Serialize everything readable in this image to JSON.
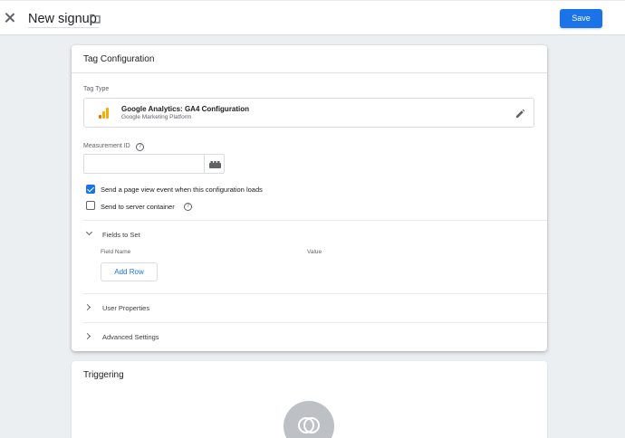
{
  "header": {
    "close_icon": "close-icon",
    "title": "New signup",
    "folder_icon": "folder-icon",
    "save_label": "Save"
  },
  "tag_config": {
    "title": "Tag Configuration",
    "tag_type_label": "Tag Type",
    "tag_type": {
      "name": "Google Analytics: GA4 Configuration",
      "provider": "Google Marketing Platform",
      "icon": "google-analytics-icon",
      "edit_icon": "pencil-icon"
    },
    "measurement_id": {
      "label": "Measurement ID",
      "value": "",
      "help_icon": "help-icon",
      "variable_icon": "variable-picker-icon"
    },
    "options": [
      {
        "label": "Send a page view event when this configuration loads",
        "checked": true
      },
      {
        "label": "Send to server container",
        "checked": false
      }
    ],
    "fields_to_set": {
      "title": "Fields to Set",
      "expanded": true,
      "columns": [
        "Field Name",
        "Value"
      ],
      "add_row_label": "Add Row"
    },
    "user_properties": {
      "title": "User Properties",
      "expanded": false
    },
    "advanced_settings": {
      "title": "Advanced Settings",
      "expanded": false
    }
  },
  "triggering": {
    "title": "Triggering",
    "icon": "trigger-icon"
  },
  "colors": {
    "accent": "#1a73e8",
    "ga_orange": "#f9ab00",
    "ga_dark_orange": "#e37400"
  }
}
